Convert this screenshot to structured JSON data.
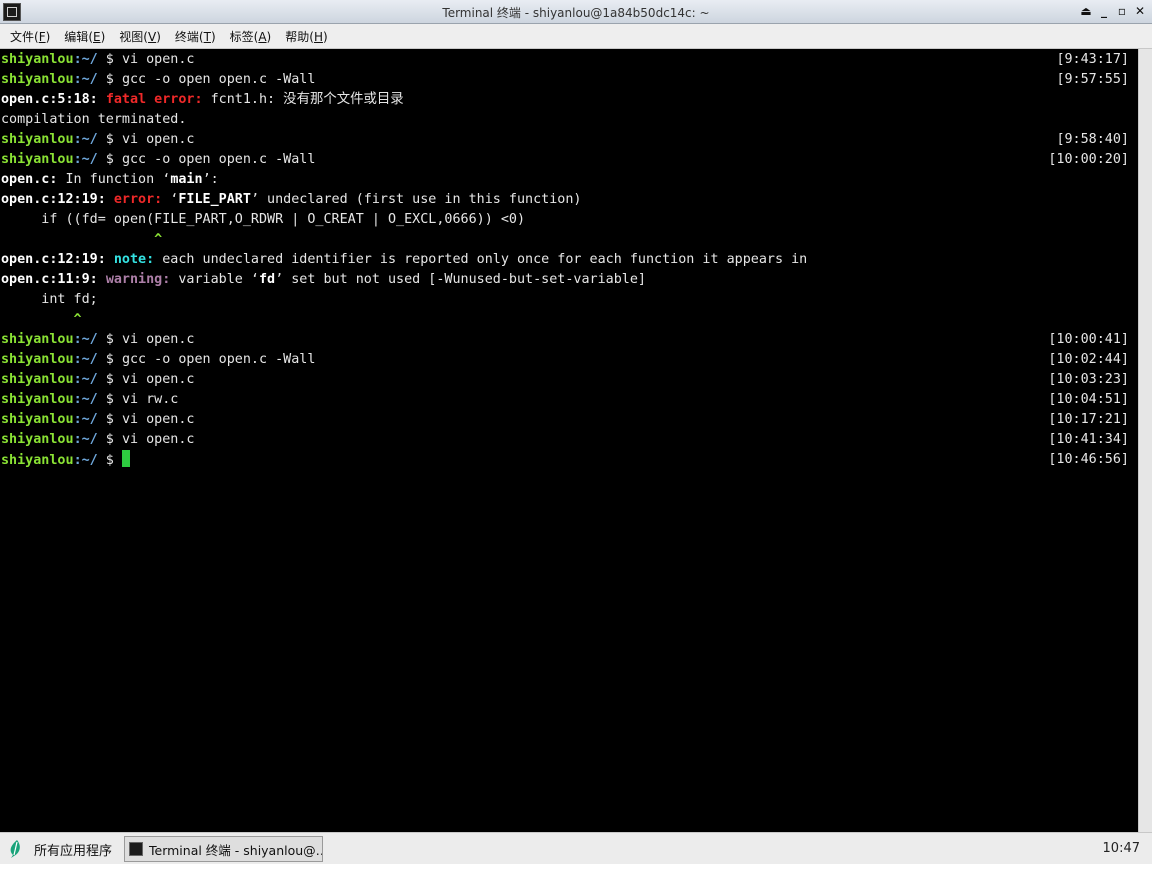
{
  "window": {
    "title": "Terminal 终端 - shiyanlou@1a84b50dc14c: ~",
    "controls": [
      "⏏",
      "_",
      "▫",
      "✕"
    ]
  },
  "menu": [
    {
      "label": "文件",
      "key": "F"
    },
    {
      "label": "编辑",
      "key": "E"
    },
    {
      "label": "视图",
      "key": "V"
    },
    {
      "label": "终端",
      "key": "T"
    },
    {
      "label": "标签",
      "key": "A"
    },
    {
      "label": "帮助",
      "key": "H"
    }
  ],
  "terminal": {
    "prompt_user": "shiyanlou",
    "prompt_path": ":~/",
    "prompt_sign": " $ ",
    "lines": [
      {
        "type": "prompt",
        "cmd": "vi open.c",
        "ts": "[9:43:17]"
      },
      {
        "type": "prompt",
        "cmd": "gcc -o open open.c -Wall",
        "ts": "[9:57:55]"
      },
      {
        "type": "diag",
        "loc": "open.c:5:18:",
        "kind": "fatal error:",
        "cls": "err",
        "msg": " fcnt1.h: 没有那个文件或目录"
      },
      {
        "type": "plain",
        "text": "compilation terminated."
      },
      {
        "type": "prompt",
        "cmd": "vi open.c",
        "ts": "[9:58:40]"
      },
      {
        "type": "prompt",
        "cmd": "gcc -o open open.c -Wall",
        "ts": "[10:00:20]"
      },
      {
        "type": "func",
        "loc": "open.c:",
        "pre": " In function ‘",
        "name": "main",
        "post": "’:"
      },
      {
        "type": "diag2",
        "loc": "open.c:12:19:",
        "kind": "error:",
        "cls": "err",
        "pre": " ‘",
        "name": "FILE_PART",
        "post": "’ undeclared (first use in this function)"
      },
      {
        "type": "plain",
        "text": "     if ((fd= open(FILE_PART,O_RDWR | O_CREAT | O_EXCL,0666)) <0)"
      },
      {
        "type": "caret",
        "text": "                   ^"
      },
      {
        "type": "diag",
        "loc": "open.c:12:19:",
        "kind": "note:",
        "cls": "note",
        "msg": " each undeclared identifier is reported only once for each function it appears in"
      },
      {
        "type": "diag2",
        "loc": "open.c:11:9:",
        "kind": "warning:",
        "cls": "warn",
        "pre": " variable ‘",
        "name": "fd",
        "post": "’ set but not used [-Wunused-but-set-variable]"
      },
      {
        "type": "plain",
        "text": "     int fd;"
      },
      {
        "type": "caret",
        "text": "         ^"
      },
      {
        "type": "prompt",
        "cmd": "vi open.c",
        "ts": "[10:00:41]"
      },
      {
        "type": "prompt",
        "cmd": "gcc -o open open.c -Wall",
        "ts": "[10:02:44]"
      },
      {
        "type": "prompt",
        "cmd": "vi open.c",
        "ts": "[10:03:23]"
      },
      {
        "type": "prompt",
        "cmd": "vi rw.c",
        "ts": "[10:04:51]"
      },
      {
        "type": "prompt",
        "cmd": "vi open.c",
        "ts": "[10:17:21]"
      },
      {
        "type": "prompt",
        "cmd": "vi open.c",
        "ts": "[10:41:34]"
      },
      {
        "type": "cursor",
        "ts": "[10:46:56]"
      }
    ]
  },
  "taskbar": {
    "start_label": "所有应用程序",
    "task_label": "Terminal 终端 - shiyanlou@…",
    "clock": "10:47"
  },
  "colors": {
    "prompt_user": "#8ae234",
    "prompt_path": "#6fa8dc",
    "error": "#ef2929",
    "note": "#34e2e2",
    "warning": "#ad7fa8",
    "cursor": "#2ecc40"
  }
}
